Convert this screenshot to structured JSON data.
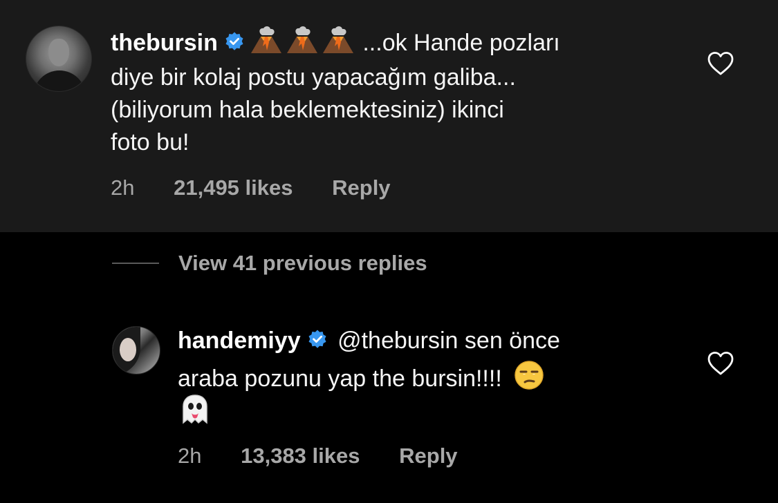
{
  "comments": [
    {
      "username": "thebursin",
      "verified_icon": "verified-badge-icon",
      "emoji_icons": [
        "volcano-emoji",
        "volcano-emoji",
        "volcano-emoji"
      ],
      "text_lines": [
        "...ok Hande pozları",
        "diye bir kolaj postu yapacağım galiba...",
        "(biliyorum hala beklemektesiniz) ikinci",
        "foto bu!"
      ],
      "time": "2h",
      "likes": "21,495 likes",
      "reply_label": "Reply",
      "like_icon": "heart-outline-icon"
    }
  ],
  "replies": {
    "view_label": "View 41 previous replies",
    "items": [
      {
        "username": "handemiyy",
        "verified_icon": "verified-badge-icon",
        "text_lines": [
          "@thebursin sen önce",
          "araba pozunu yap the bursin!!!!"
        ],
        "emoji_icons": [
          "unamused-face-emoji",
          "ghost-emoji"
        ],
        "time": "2h",
        "likes": "13,383 likes",
        "reply_label": "Reply",
        "like_icon": "heart-outline-icon"
      }
    ]
  },
  "colors": {
    "background": "#000000",
    "highlighted_comment_background": "#1a1a1a",
    "primary_text": "#ffffff",
    "secondary_text": "#a8a8a8",
    "verified_blue": "#3897f0"
  }
}
